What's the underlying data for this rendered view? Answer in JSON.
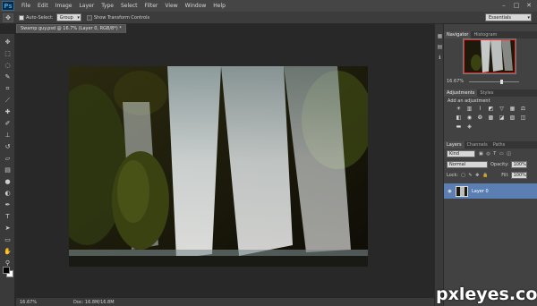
{
  "app": {
    "logo": "Ps"
  },
  "menu": [
    "File",
    "Edit",
    "Image",
    "Layer",
    "Type",
    "Select",
    "Filter",
    "View",
    "Window",
    "Help"
  ],
  "window_controls": {
    "minimize": "–",
    "restore": "□",
    "close": "✕"
  },
  "options_bar": {
    "tool_icon": "move-tool-icon",
    "auto_select_label": "Auto-Select:",
    "auto_select_checked": true,
    "auto_select_value": "Group",
    "show_transform_label": "Show Transform Controls",
    "show_transform_checked": false,
    "workspace": "Essentials"
  },
  "document": {
    "tab_label": "Swamp guy.psd @ 16.7% (Layer 0, RGB/8*) *"
  },
  "status_bar": {
    "zoom": "16.67%",
    "doc_info": "Doc: 16.8M/16.8M"
  },
  "tools": [
    "move",
    "marquee",
    "lasso",
    "quick-select",
    "crop",
    "eyedropper",
    "healing",
    "brush",
    "clone-stamp",
    "history-brush",
    "eraser",
    "gradient",
    "blur",
    "dodge",
    "pen",
    "type",
    "path-select",
    "shape",
    "hand",
    "zoom"
  ],
  "colors": {
    "foreground": "#000000",
    "background": "#ffffff",
    "accent": "#5b7fb2",
    "nav_box": "#e23030"
  },
  "navigator_panel": {
    "tabs": [
      "Navigator",
      "Histogram"
    ],
    "zoom": "16.67%"
  },
  "adjustments_panel": {
    "tabs": [
      "Adjustments",
      "Styles"
    ],
    "title": "Add an adjustment",
    "icons": [
      "brightness-contrast",
      "levels",
      "curves",
      "exposure",
      "vibrance",
      "hue-saturation",
      "color-balance",
      "black-white",
      "photo-filter",
      "channel-mixer",
      "color-lookup",
      "invert",
      "posterize",
      "threshold",
      "gradient-map",
      "selective-color"
    ]
  },
  "layers_panel": {
    "tabs": [
      "Layers",
      "Channels",
      "Paths"
    ],
    "filter": "Kind",
    "blend_mode": "Normal",
    "opacity_label": "Opacity:",
    "opacity": "100%",
    "lock_label": "Lock:",
    "fill_label": "Fill:",
    "fill": "100%",
    "layers": [
      {
        "name": "Layer 0",
        "visible": true,
        "selected": true
      }
    ]
  },
  "watermark": "pxleyes.com"
}
